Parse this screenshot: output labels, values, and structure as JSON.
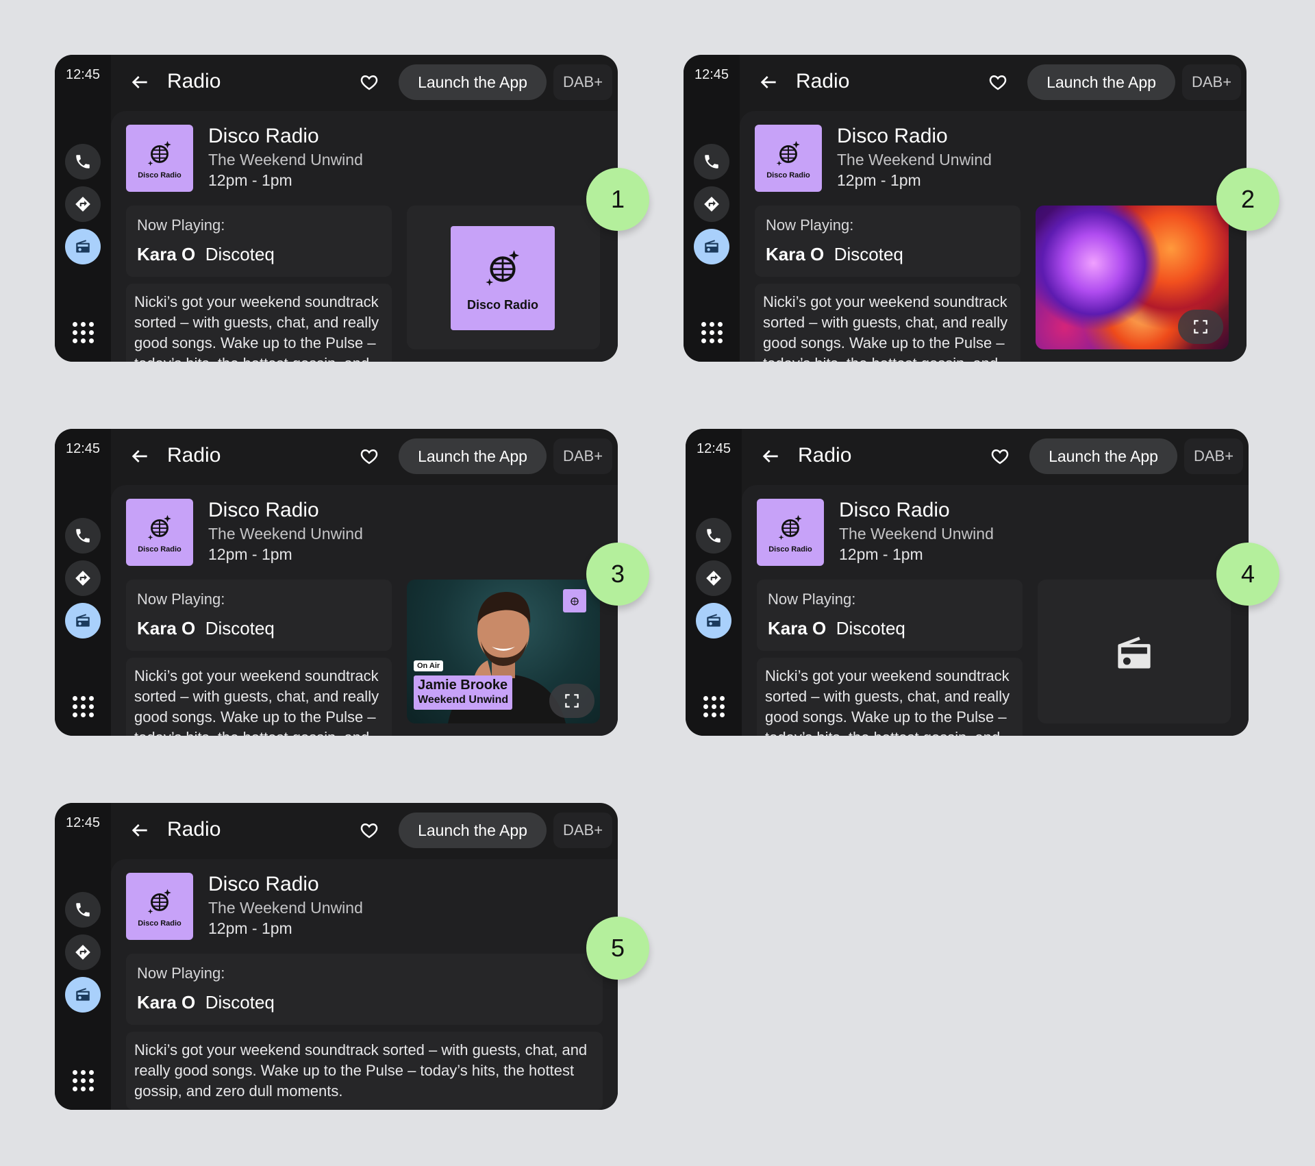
{
  "screens": [
    {
      "badge": "1",
      "clock": "12:45",
      "title": "Radio",
      "launch_label": "Launch the App",
      "band_label": "DAB+",
      "station": {
        "name": "Disco Radio",
        "show": "The Weekend Unwind",
        "time": "12pm - 1pm",
        "logo_label": "Disco Radio"
      },
      "now_playing": {
        "label": "Now Playing:",
        "artist": "Kara O",
        "track": "Discoteq"
      },
      "description": "Nicki’s got your weekend soundtrack sorted – with guests, chat, and really good songs. Wake up to the Pulse – today’s hits, the hottest gossip, and zero dull moments.",
      "artwork": {
        "kind": "station-logo",
        "logo_label": "Disco Radio"
      }
    },
    {
      "badge": "2",
      "clock": "12:45",
      "title": "Radio",
      "launch_label": "Launch the App",
      "band_label": "DAB+",
      "station": {
        "name": "Disco Radio",
        "show": "The Weekend Unwind",
        "time": "12pm - 1pm",
        "logo_label": "Disco Radio"
      },
      "now_playing": {
        "label": "Now Playing:",
        "artist": "Kara O",
        "track": "Discoteq"
      },
      "description": "Nicki’s got your weekend soundtrack sorted – with guests, chat, and really good songs. Wake up to the Pulse – today’s hits, the hottest gossip, and zero dull moments.",
      "artwork": {
        "kind": "abstract-image"
      }
    },
    {
      "badge": "3",
      "clock": "12:45",
      "title": "Radio",
      "launch_label": "Launch the App",
      "band_label": "DAB+",
      "station": {
        "name": "Disco Radio",
        "show": "The Weekend Unwind",
        "time": "12pm - 1pm",
        "logo_label": "Disco Radio"
      },
      "now_playing": {
        "label": "Now Playing:",
        "artist": "Kara O",
        "track": "Discoteq"
      },
      "description": "Nicki’s got your weekend soundtrack sorted – with guests, chat, and really good songs. Wake up to the Pulse – today’s hits, the hottest gossip, and zero dull moments.",
      "artwork": {
        "kind": "presenter-photo",
        "on_air": "On Air",
        "presenter": "Jamie Brooke",
        "show": "Weekend Unwind"
      }
    },
    {
      "badge": "4",
      "clock": "12:45",
      "title": "Radio",
      "launch_label": "Launch the App",
      "band_label": "DAB+",
      "station": {
        "name": "Disco Radio",
        "show": "The Weekend Unwind",
        "time": "12pm - 1pm",
        "logo_label": "Disco Radio"
      },
      "now_playing": {
        "label": "Now Playing:",
        "artist": "Kara O",
        "track": "Discoteq"
      },
      "description": "Nicki’s got your weekend soundtrack sorted – with guests, chat, and really good songs. Wake up to the Pulse – today’s hits, the hottest gossip, and zero dull moments.",
      "artwork": {
        "kind": "radio-placeholder"
      }
    },
    {
      "badge": "5",
      "clock": "12:45",
      "title": "Radio",
      "launch_label": "Launch the App",
      "band_label": "DAB+",
      "station": {
        "name": "Disco Radio",
        "show": "The Weekend Unwind",
        "time": "12pm - 1pm",
        "logo_label": "Disco Radio"
      },
      "now_playing": {
        "label": "Now Playing:",
        "artist": "Kara O",
        "track": "Discoteq"
      },
      "description": "Nicki’s got your weekend soundtrack sorted – with guests, chat, and really good songs. Wake up to the Pulse – today’s hits, the hottest gossip, and zero dull moments.",
      "artwork": {
        "kind": "none"
      }
    }
  ],
  "colors": {
    "background": "#e0e1e4",
    "screen": "#1b1b1c",
    "accent_purple": "#c7a2f8",
    "active_blue": "#a9d0fb",
    "badge_green": "#b4ef9c"
  },
  "icons": [
    "phone-icon",
    "navigation-icon",
    "radio-icon",
    "app-grid-icon",
    "back-arrow-icon",
    "heart-icon",
    "signal-icon",
    "disco-ball-icon",
    "expand-icon"
  ]
}
